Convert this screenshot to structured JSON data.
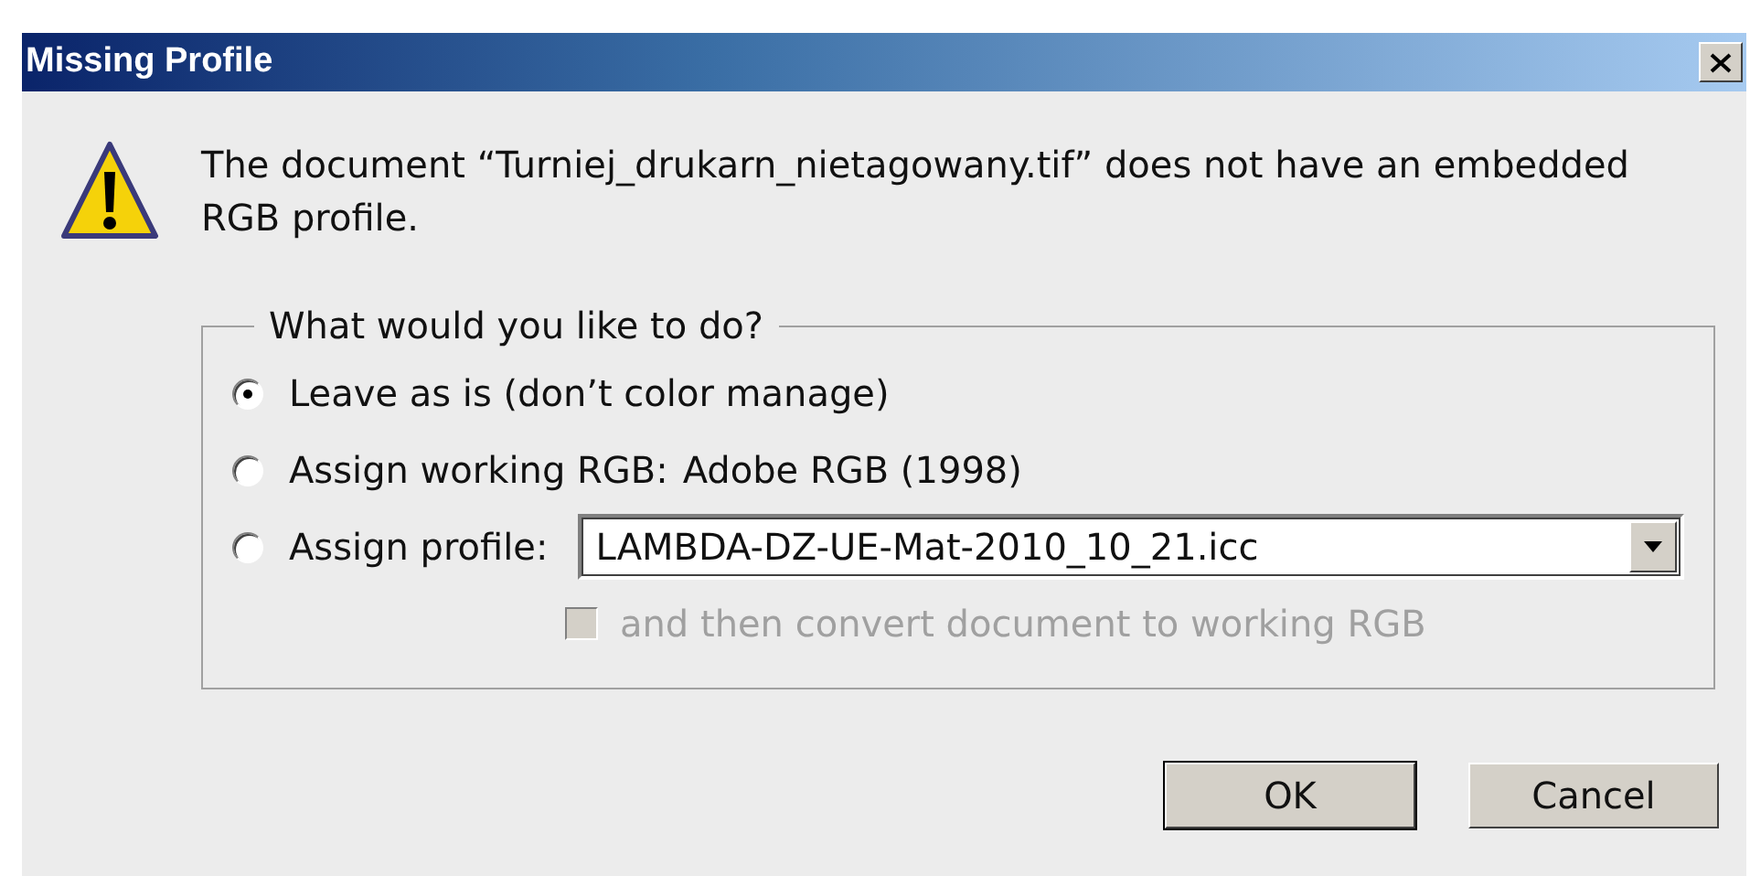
{
  "window": {
    "title": "Missing Profile"
  },
  "message": "The document “Turniej_drukarn_nietagowany.tif” does not have an embedded RGB profile.",
  "group": {
    "legend": "What would you like to do?",
    "options": [
      {
        "kind": "plain",
        "label": "Leave as is (don’t color manage)",
        "selected": true
      },
      {
        "kind": "value",
        "label": "Assign working RGB:",
        "value": "Adobe RGB (1998)",
        "selected": false
      },
      {
        "kind": "dropdown",
        "label": "Assign profile:",
        "dropdown": "LAMBDA-DZ-UE-Mat-2010_10_21.icc",
        "selected": false
      }
    ],
    "convert": {
      "label": "and then convert document to working RGB",
      "checked": false,
      "disabled": true
    }
  },
  "buttons": [
    {
      "label": "OK",
      "default": true
    },
    {
      "label": "Cancel",
      "default": false
    }
  ]
}
